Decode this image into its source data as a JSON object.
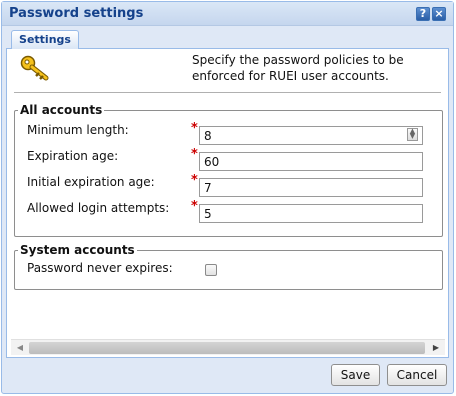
{
  "window": {
    "title": "Password settings",
    "help_glyph": "?",
    "close_glyph": "×"
  },
  "tabs": [
    {
      "label": "Settings",
      "active": true
    }
  ],
  "intro": {
    "icon": "key-icon",
    "text": "Specify the password policies to be enforced for RUEI user accounts."
  },
  "all_accounts": {
    "legend": "All accounts",
    "fields": [
      {
        "label": "Minimum length:",
        "value": "8",
        "required": true
      },
      {
        "label": "Expiration age:",
        "value": "60",
        "required": true
      },
      {
        "label": "Initial expiration age:",
        "value": "7",
        "required": true
      },
      {
        "label": "Allowed login attempts:",
        "value": "5",
        "required": true
      }
    ],
    "required_mark": "*"
  },
  "system_accounts": {
    "legend": "System accounts",
    "never_expires_label": "Password never expires:",
    "never_expires_checked": false
  },
  "buttons": {
    "save": "Save",
    "cancel": "Cancel"
  },
  "colors": {
    "title_text": "#15428b",
    "frame": "#dfe8f6",
    "required": "#cc0000"
  }
}
